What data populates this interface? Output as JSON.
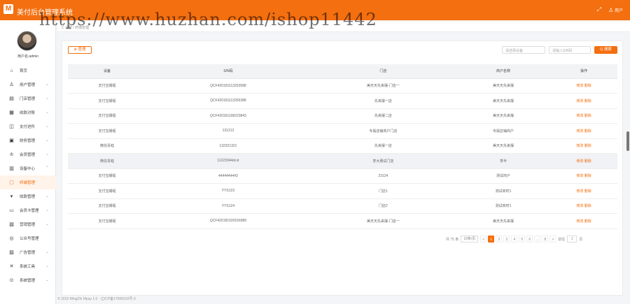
{
  "header": {
    "logo": "M",
    "title": "美付后台管理系统",
    "user": "用户",
    "expand_icon": "expand-icon",
    "user_icon": "user-icon"
  },
  "watermark": "https://www.huzhan.com/ishop11442",
  "sidebar": {
    "username": "用户名:admin",
    "items": [
      {
        "label": "首页",
        "icon": "⌂",
        "chev": ""
      },
      {
        "label": "用户管理",
        "icon": "♙",
        "chev": "⌄"
      },
      {
        "label": "门店管理",
        "icon": "▤",
        "chev": "⌄"
      },
      {
        "label": "收款对账",
        "icon": "▦",
        "chev": "⌄"
      },
      {
        "label": "支付进件",
        "icon": "◫",
        "chev": "⌄"
      },
      {
        "label": "财务管理",
        "icon": "▣",
        "chev": "⌄"
      },
      {
        "label": "会员管理",
        "icon": "♔",
        "chev": "⌄"
      },
      {
        "label": "设备中心",
        "icon": "▥",
        "chev": "⌃"
      },
      {
        "label": "终端管理",
        "icon": "▢",
        "chev": ""
      },
      {
        "label": "收款管理",
        "icon": "▾",
        "chev": "⌄"
      },
      {
        "label": "会员卡管理",
        "icon": "▭",
        "chev": "⌄"
      },
      {
        "label": "营销管理",
        "icon": "▧",
        "chev": "⌄"
      },
      {
        "label": "公众号管理",
        "icon": "◎",
        "chev": ""
      },
      {
        "label": "广告管理",
        "icon": "▨",
        "chev": "⌄"
      },
      {
        "label": "系统工具",
        "icon": "✕",
        "chev": "⌄"
      },
      {
        "label": "系统管理",
        "icon": "⊙",
        "chev": "⌄"
      }
    ]
  },
  "breadcrumb": "C 设备 / 终端管理",
  "toolbar": {
    "manage": "⊕ 管理",
    "device_select": "请选择设备",
    "sn_input": "请输入S/N码",
    "search": "Q 搜索"
  },
  "table": {
    "headers": [
      "设备",
      "S/N码",
      "门店",
      "商户名称",
      "操作"
    ],
    "rows": [
      [
        "支付宝蜻蜓",
        "QCF420181113253588",
        "美天天先来摆-门店一",
        "美天天先来摆",
        "修改 删除"
      ],
      [
        "支付宝蜻蜓",
        "QCF420181113256388",
        "先来摆一店",
        "美天天先来摆",
        "修改 删除"
      ],
      [
        "支付宝蜻蜓",
        "QCF420181108223843",
        "先来摆二店",
        "美天天先来摆",
        "修改 删除"
      ],
      [
        "支付宝蜻蜓",
        "131313",
        "专属店铺商户门店",
        "专属店铺商户",
        "修改 删除"
      ],
      [
        "微信青蛙",
        "132321321",
        "先来摆一店",
        "美天天先来摆",
        "修改 删除"
      ],
      [
        "微信青蛙",
        "11223344dcvt",
        "李大朋试门店",
        "李半",
        "修改 删除"
      ],
      [
        "支付宝蜻蜓",
        "4444444443",
        "23124",
        "测试商户",
        "修改 删除"
      ],
      [
        "支付宝蜻蜓",
        "YYS123",
        "门店1",
        "测试商时1",
        "修改 删除"
      ],
      [
        "支付宝蜻蜓",
        "YYS124",
        "门店2",
        "测试商时1",
        "修改 删除"
      ],
      [
        "支付宝蜻蜓",
        "QCF420181020156989",
        "美天天先来摆-门店一",
        "美天天先来摆",
        "修改 删除"
      ]
    ]
  },
  "pager": {
    "total": "共 75 条",
    "size": "10条/页",
    "pages": [
      "<",
      "1",
      "2",
      "3",
      "4",
      "5",
      "6",
      "…",
      "8",
      ">"
    ],
    "goto": "前往",
    "goto_value": "1",
    "page_unit": "页"
  },
  "footer": "© 2019 MingZhi Mpay 1.0 · 辽ICP备17006916号-3"
}
